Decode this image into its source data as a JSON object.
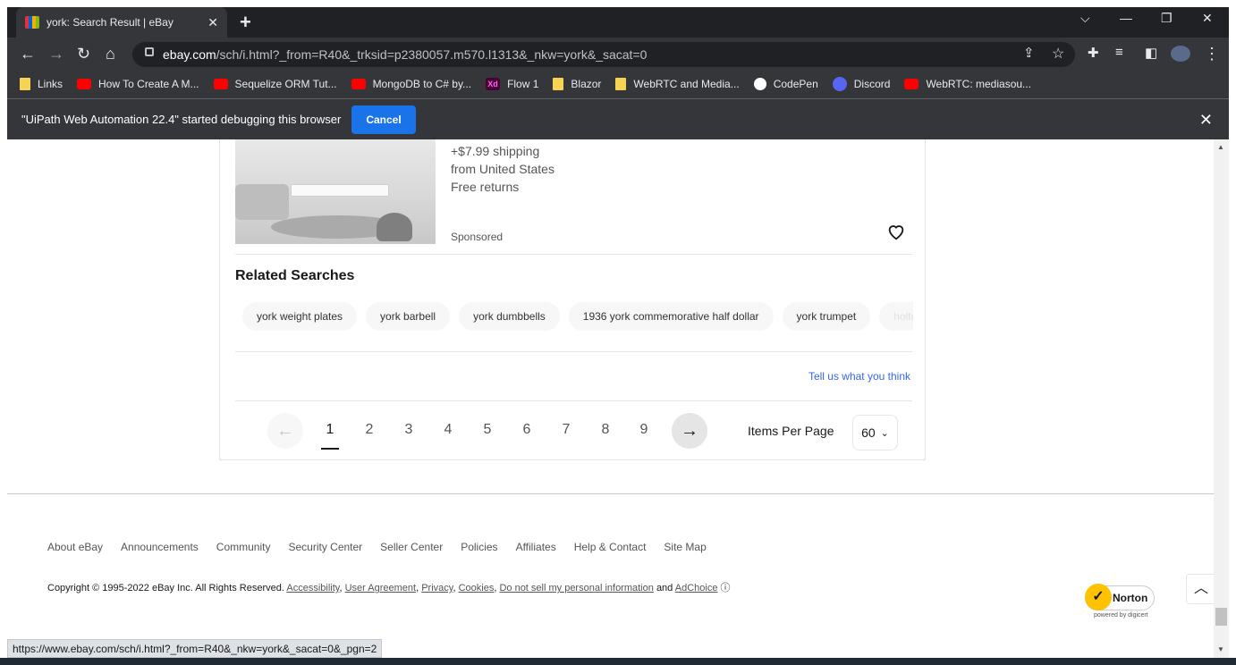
{
  "browser": {
    "tab_title": "york: Search Result | eBay",
    "url_host": "ebay.com",
    "url_path": "/sch/i.html?_from=R40&_trksid=p2380057.m570.l1313&_nkw=york&_sacat=0",
    "bookmarks": [
      {
        "label": "Links",
        "icon": "folder-icon"
      },
      {
        "label": "How To Create A M...",
        "icon": "youtube-icon"
      },
      {
        "label": "Sequelize ORM Tut...",
        "icon": "youtube-icon"
      },
      {
        "label": "MongoDB to C# by...",
        "icon": "youtube-icon"
      },
      {
        "label": "Flow 1",
        "icon": "adobe-xd-icon"
      },
      {
        "label": "Blazor",
        "icon": "folder-icon"
      },
      {
        "label": "WebRTC and Media...",
        "icon": "folder-icon"
      },
      {
        "label": "CodePen",
        "icon": "codepen-icon"
      },
      {
        "label": "Discord",
        "icon": "discord-icon"
      },
      {
        "label": "WebRTC: mediasou...",
        "icon": "youtube-icon"
      }
    ],
    "debug_message": "\"UiPath Web Automation 22.4\" started debugging this browser",
    "cancel_label": "Cancel",
    "status_url": "https://www.ebay.com/sch/i.html?_from=R40&_nkw=york&_sacat=0&_pgn=2"
  },
  "listing": {
    "shipping": "+$7.99 shipping",
    "origin": "from United States",
    "returns": "Free returns",
    "sponsored": "Sponsored"
  },
  "related": {
    "title": "Related Searches",
    "chips": [
      "york weight plates",
      "york barbell",
      "york dumbbells",
      "1936 york commemorative half dollar",
      "york trumpet",
      "holto"
    ]
  },
  "feedback_link": "Tell us what you think",
  "pagination": {
    "pages": [
      "1",
      "2",
      "3",
      "4",
      "5",
      "6",
      "7",
      "8",
      "9"
    ],
    "current": "1",
    "items_per_page_label": "Items Per Page",
    "items_per_page_value": "60"
  },
  "footer": {
    "links": [
      "About eBay",
      "Announcements",
      "Community",
      "Security Center",
      "Seller Center",
      "Policies",
      "Affiliates",
      "Help & Contact",
      "Site Map"
    ],
    "copyright_prefix": "Copyright © 1995-2022 eBay Inc. All Rights Reserved.",
    "legal_links": [
      "Accessibility",
      "User Agreement",
      "Privacy",
      "Cookies",
      "Do not sell my personal information"
    ],
    "and_text": "and",
    "adchoice": "AdChoice",
    "norton": "Norton",
    "norton_powered": "powered by digicert"
  }
}
